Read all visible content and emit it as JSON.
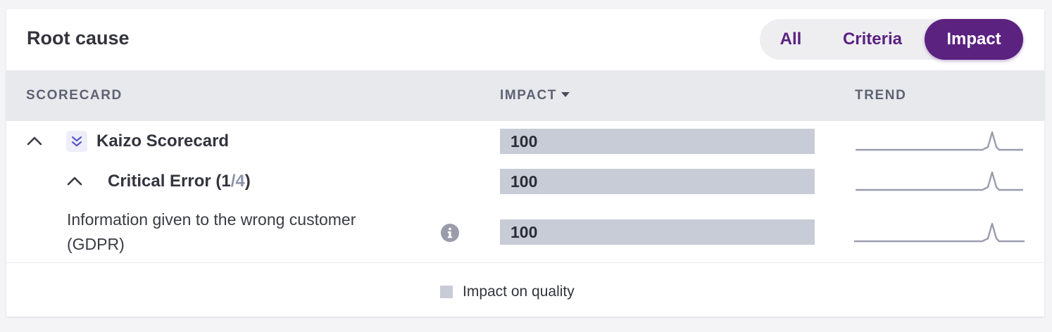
{
  "card": {
    "title": "Root cause"
  },
  "view_toggle": {
    "options": [
      "All",
      "Criteria",
      "Impact"
    ],
    "selected": "Impact"
  },
  "table": {
    "headers": {
      "scorecard": "SCORECARD",
      "impact": "IMPACT",
      "trend": "TREND"
    },
    "sort": {
      "column": "impact",
      "direction": "descending"
    },
    "rows": [
      {
        "label": "Kaizo Scorecard",
        "impact": "100",
        "level": 0,
        "expanded": true
      },
      {
        "label": "Critical Error",
        "count_open": "(",
        "count_current": "1",
        "count_sep": "/",
        "count_total": "4",
        "count_close": ")",
        "impact": "100",
        "level": 1,
        "expanded": true
      },
      {
        "label": "Information given to the wrong customer (GDPR)",
        "impact": "100",
        "level": 2
      }
    ]
  },
  "legend": {
    "label": "Impact on quality",
    "color": "#c8ccd7"
  },
  "colors": {
    "accent": "#5b2280",
    "bar": "#c8ccd7",
    "header_bg": "#e8e9ec",
    "sparkline": "#9a9daf"
  },
  "icons": {
    "collapse": "chevron-up-icon",
    "expand_all": "double-chevron-down-icon",
    "info": "info-icon",
    "sort": "caret-down-icon"
  }
}
